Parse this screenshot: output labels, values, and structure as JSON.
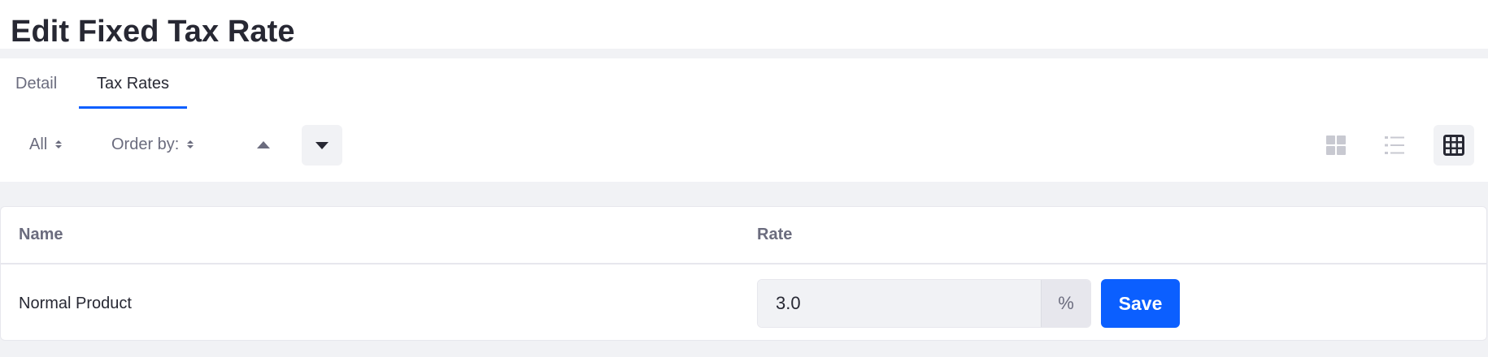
{
  "page": {
    "title": "Edit Fixed Tax Rate"
  },
  "tabs": [
    {
      "label": "Detail",
      "active": false
    },
    {
      "label": "Tax Rates",
      "active": true
    }
  ],
  "toolbar": {
    "filter_label": "All",
    "order_by_label": "Order by:",
    "sort_ascending_icon": "caret-up-icon",
    "sort_descending_icon": "caret-down-icon",
    "view_modes": [
      {
        "name": "cards",
        "icon": "cards-icon",
        "active": false
      },
      {
        "name": "list",
        "icon": "list-icon",
        "active": false
      },
      {
        "name": "table",
        "icon": "table-icon",
        "active": true
      }
    ]
  },
  "table": {
    "columns": [
      "Name",
      "Rate"
    ],
    "rows": [
      {
        "name": "Normal Product",
        "rate_value": "3.0",
        "rate_suffix": "%",
        "save_label": "Save"
      }
    ]
  },
  "colors": {
    "primary": "#0b5fff",
    "text": "#272833",
    "secondary_text": "#6b6c7e",
    "background": "#f1f2f5"
  }
}
